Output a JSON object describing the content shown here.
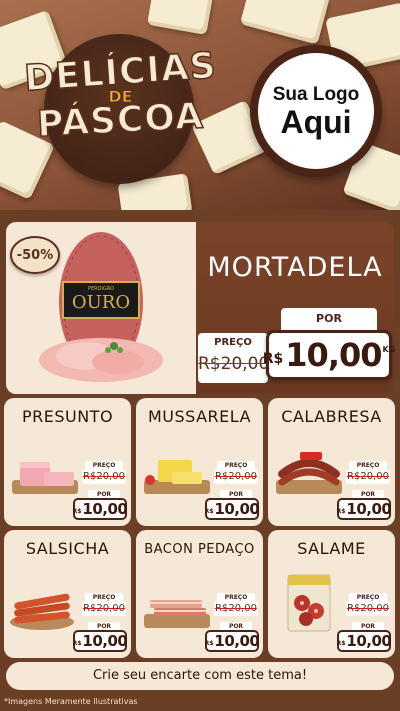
{
  "header": {
    "title_line1": "DELÍCIAS",
    "title_line2": "DE",
    "title_line3": "PÁSCOA",
    "logo_line1": "Sua Logo",
    "logo_line2": "Aqui"
  },
  "featured": {
    "name": "MORTADELA",
    "discount": "-50%",
    "brand": "OURO",
    "brand_small": "PERDIGÃO",
    "preco_label": "PREÇO",
    "old_price": "R$20,00",
    "por_label": "POR",
    "currency": "R$",
    "price": "10,00",
    "unit": "KG"
  },
  "products": [
    {
      "name": "PRESUNTO",
      "preco_label": "PREÇO",
      "old_price": "R$20,00",
      "por_label": "POR",
      "currency": "R$",
      "price": "10,00"
    },
    {
      "name": "MUSSARELA",
      "preco_label": "PREÇO",
      "old_price": "R$20,00",
      "por_label": "POR",
      "currency": "R$",
      "price": "10,00"
    },
    {
      "name": "CALABRESA",
      "preco_label": "PREÇO",
      "old_price": "R$20,00",
      "por_label": "POR",
      "currency": "R$",
      "price": "10,00"
    },
    {
      "name": "SALSICHA",
      "preco_label": "PREÇO",
      "old_price": "R$20,00",
      "por_label": "POR",
      "currency": "R$",
      "price": "10,00"
    },
    {
      "name": "BACON PEDAÇO",
      "preco_label": "PREÇO",
      "old_price": "R$20,00",
      "por_label": "POR",
      "currency": "R$",
      "price": "10,00"
    },
    {
      "name": "SALAME",
      "preco_label": "PREÇO",
      "old_price": "R$20,00",
      "por_label": "POR",
      "currency": "R$",
      "price": "10,00"
    }
  ],
  "footer": {
    "cta": "Crie seu encarte com este tema!",
    "disclaimer": "*Imagens Meramente Ilustrativas"
  },
  "colors": {
    "chocolate_dark": "#4a2415",
    "chocolate_mid": "#6b3e26",
    "cream": "#f5e8d6",
    "strike_red": "#c81e1e"
  }
}
